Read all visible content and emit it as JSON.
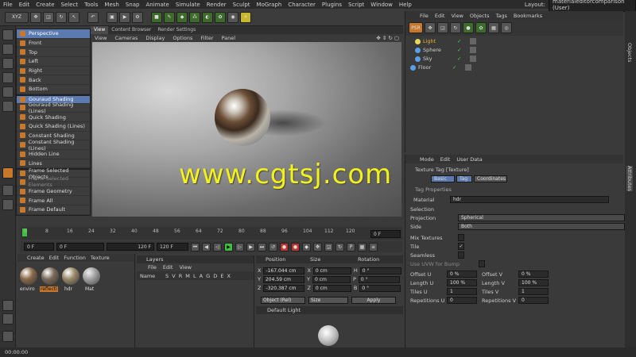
{
  "menubar": {
    "items": [
      "File",
      "Edit",
      "Create",
      "Select",
      "Tools",
      "Mesh",
      "Snap",
      "Animate",
      "Simulate",
      "Render",
      "Sculpt",
      "MoGraph",
      "Character",
      "Plugins",
      "Script",
      "Window",
      "Help"
    ],
    "layout_label": "Layout:",
    "layout_value": "materialeditorcomparison (User)"
  },
  "toolbar": {
    "xyz": "XYZ"
  },
  "display_menu": {
    "items": [
      {
        "label": "Perspective",
        "selected": true
      },
      {
        "label": "Front"
      },
      {
        "label": "Top"
      },
      {
        "label": "Left"
      },
      {
        "label": "Right"
      },
      {
        "label": "Back"
      },
      {
        "label": "Bottom"
      },
      {
        "label": "Gouraud Shading",
        "selected": true
      },
      {
        "label": "Gouraud Shading (Lines)"
      },
      {
        "label": "Quick Shading"
      },
      {
        "label": "Quick Shading (Lines)"
      },
      {
        "label": "Constant Shading"
      },
      {
        "label": "Constant Shading (Lines)"
      },
      {
        "label": "Hidden Line"
      },
      {
        "label": "Lines"
      },
      {
        "label": "Frame Selected Objects"
      },
      {
        "label": "Frame Selected Elements",
        "dim": true
      },
      {
        "label": "Frame Geometry"
      },
      {
        "label": "Frame All"
      },
      {
        "label": "Frame Default"
      }
    ]
  },
  "viewport": {
    "tabs": [
      "View",
      "Content Browser",
      "Render Settings"
    ],
    "menu": [
      "View",
      "Cameras",
      "Display",
      "Options",
      "Filter",
      "Panel"
    ],
    "watermark": "www.cgtsj.com"
  },
  "timeline": {
    "ticks": [
      "0",
      "8",
      "16",
      "24",
      "32",
      "40",
      "48",
      "56",
      "64",
      "72",
      "80",
      "88",
      "96",
      "104",
      "112",
      "120"
    ],
    "frame_field": "0 F",
    "start": "0 F",
    "current": "0 F",
    "end": "120 F",
    "end2": "120 F"
  },
  "material_manager": {
    "menu": [
      "Create",
      "Edit",
      "Function",
      "Texture"
    ],
    "materials": [
      "enviro",
      "reflecti",
      "hdr",
      "Mat"
    ]
  },
  "layers": {
    "title": "Layers",
    "menu": [
      "File",
      "Edit",
      "View"
    ],
    "header_name": "Name",
    "header_cols": "S V R M L A G D E X"
  },
  "coordinates": {
    "headers": [
      "Position",
      "Size",
      "Rotation"
    ],
    "rows": [
      {
        "axis": "X",
        "pos": "-167.044 cm",
        "size": "0 cm",
        "rot_label": "H",
        "rot": "0 °"
      },
      {
        "axis": "Y",
        "pos": "204.59 cm",
        "size": "0 cm",
        "rot_label": "P",
        "rot": "0 °"
      },
      {
        "axis": "Z",
        "pos": "-320.387 cm",
        "size": "0 cm",
        "rot_label": "B",
        "rot": "0 °"
      }
    ],
    "mode": "Object (Rel)",
    "size_mode": "Size",
    "apply": "Apply",
    "preset": "Default Light"
  },
  "object_manager": {
    "menu": [
      "File",
      "Edit",
      "View",
      "Objects",
      "Tags",
      "Bookmarks"
    ],
    "objects": [
      "Light",
      "Sphere",
      "Sky",
      "Floor"
    ]
  },
  "attributes": {
    "menu": [
      "Mode",
      "Edit",
      "User Data"
    ],
    "title": "Texture Tag [Texture]",
    "tabs": [
      "Basic",
      "Tag",
      "Coordinates"
    ],
    "section": "Tag Properties",
    "material_label": "Material",
    "material_value": "hdr",
    "selection_label": "Selection",
    "projection_label": "Projection",
    "projection_value": "Spherical",
    "side_label": "Side",
    "side_value": "Both",
    "mix_label": "Mix Textures",
    "tile_label": "Tile",
    "seamless_label": "Seamless",
    "uvw_label": "Use UVW for Bump",
    "offset_u_label": "Offset U",
    "offset_u": "0 %",
    "offset_v_label": "Offset V",
    "offset_v": "0 %",
    "length_u_label": "Length U",
    "length_u": "100 %",
    "length_v_label": "Length V",
    "length_v": "100 %",
    "tiles_u_label": "Tiles U",
    "tiles_u": "1",
    "tiles_v_label": "Tiles V",
    "tiles_v": "1",
    "rep_u_label": "Repetitions U",
    "rep_u": "0",
    "rep_v_label": "Repetitions V",
    "rep_v": "0"
  },
  "side_tabs": [
    "Objects",
    "Attributes"
  ],
  "status": {
    "time": "00:00:00"
  },
  "colors": {
    "accent": "#5a7ab0",
    "orange": "#c8782b",
    "watermark": "#f2f21a"
  }
}
